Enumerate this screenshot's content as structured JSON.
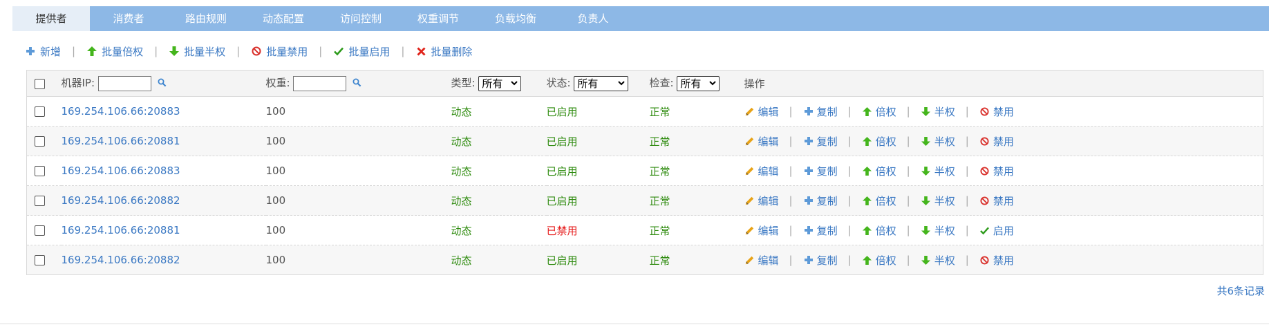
{
  "tabs": [
    {
      "label": "提供者",
      "active": true
    },
    {
      "label": "消费者",
      "active": false
    },
    {
      "label": "路由规则",
      "active": false
    },
    {
      "label": "动态配置",
      "active": false
    },
    {
      "label": "访问控制",
      "active": false
    },
    {
      "label": "权重调节",
      "active": false
    },
    {
      "label": "负载均衡",
      "active": false
    },
    {
      "label": "负责人",
      "active": false
    }
  ],
  "toolbar": {
    "add": "新增",
    "batch_double": "批量倍权",
    "batch_half": "批量半权",
    "batch_disable": "批量禁用",
    "batch_enable": "批量启用",
    "batch_delete": "批量删除"
  },
  "header": {
    "ip_label": "机器IP:",
    "weight_label": "权重:",
    "type_label": "类型:",
    "type_value": "所有",
    "status_label": "状态:",
    "status_value": "所有",
    "check_label": "检查:",
    "check_value": "所有",
    "ops_label": "操作"
  },
  "ops": {
    "edit": "编辑",
    "copy": "复制",
    "double": "倍权",
    "half": "半权",
    "disable": "禁用",
    "enable": "启用"
  },
  "rows": [
    {
      "ip": "169.254.106.66:20883",
      "weight": "100",
      "type": "动态",
      "status": "已启用",
      "check": "正常",
      "toggle": "禁用"
    },
    {
      "ip": "169.254.106.66:20881",
      "weight": "100",
      "type": "动态",
      "status": "已启用",
      "check": "正常",
      "toggle": "禁用"
    },
    {
      "ip": "169.254.106.66:20883",
      "weight": "100",
      "type": "动态",
      "status": "已启用",
      "check": "正常",
      "toggle": "禁用"
    },
    {
      "ip": "169.254.106.66:20882",
      "weight": "100",
      "type": "动态",
      "status": "已启用",
      "check": "正常",
      "toggle": "禁用"
    },
    {
      "ip": "169.254.106.66:20881",
      "weight": "100",
      "type": "动态",
      "status": "已禁用",
      "check": "正常",
      "toggle": "启用"
    },
    {
      "ip": "169.254.106.66:20882",
      "weight": "100",
      "type": "动态",
      "status": "已启用",
      "check": "正常",
      "toggle": "禁用"
    }
  ],
  "footer": {
    "total": "共6条记录"
  },
  "colors": {
    "tab_bar": "#8db8e6",
    "link": "#3a78c3",
    "green": "#2e8b0e",
    "red": "#e61b1b"
  }
}
